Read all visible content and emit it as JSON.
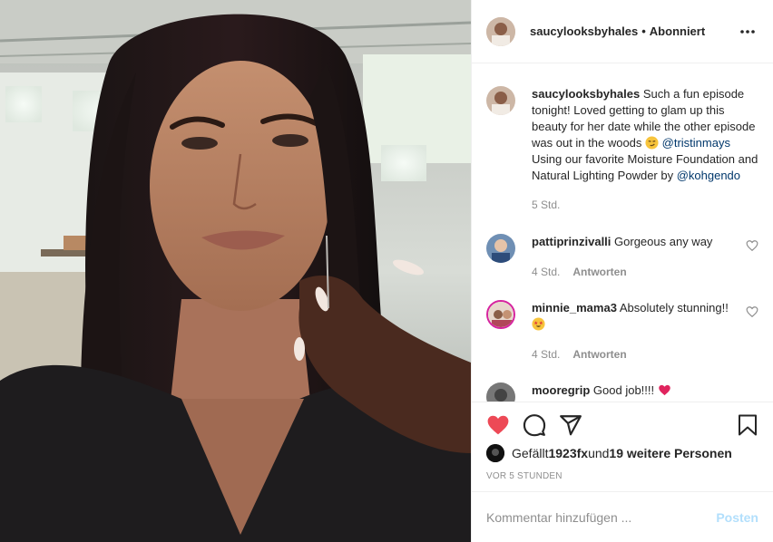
{
  "header": {
    "username": "saucylooksbyhales",
    "separator": "•",
    "follow_status": "Abonniert",
    "more_icon": "more-horizontal-icon"
  },
  "caption": {
    "username": "saucylooksbyhales",
    "text_1": "Such a fun episode tonight! Loved getting to glam up this beauty for her date while the other episode was out in the woods ",
    "mention_1": "@tristinmays",
    "text_2": " Using our favorite Moisture Foundation and Natural Lighting Powder by ",
    "mention_2": "@kohgendo",
    "age": "5 Std."
  },
  "comments": [
    {
      "username": "pattiprinzivalli",
      "text": "Gorgeous any way",
      "age": "4 Std.",
      "reply": "Antworten"
    },
    {
      "username": "minnie_mama3",
      "text": "Absolutely stunning!! ",
      "age": "4 Std.",
      "reply": "Antworten"
    },
    {
      "username": "mooregrip",
      "text": "Good job!!!! "
    }
  ],
  "actions": {
    "like_icon": "heart-filled-icon",
    "comment_icon": "comment-icon",
    "share_icon": "share-icon",
    "save_icon": "bookmark-icon",
    "like_color": "#ed4956"
  },
  "likes": {
    "prefix": "Gefällt ",
    "first_user": "1923fx",
    "middle": " und ",
    "others": "19 weitere Personen"
  },
  "timestamp": "VOR 5 STUNDEN",
  "add_comment": {
    "placeholder": "Kommentar hinzufügen ...",
    "post_label": "Posten"
  },
  "colors": {
    "link": "#00376b",
    "muted": "#8e8e8e",
    "post_disabled": "#b2dffc"
  }
}
